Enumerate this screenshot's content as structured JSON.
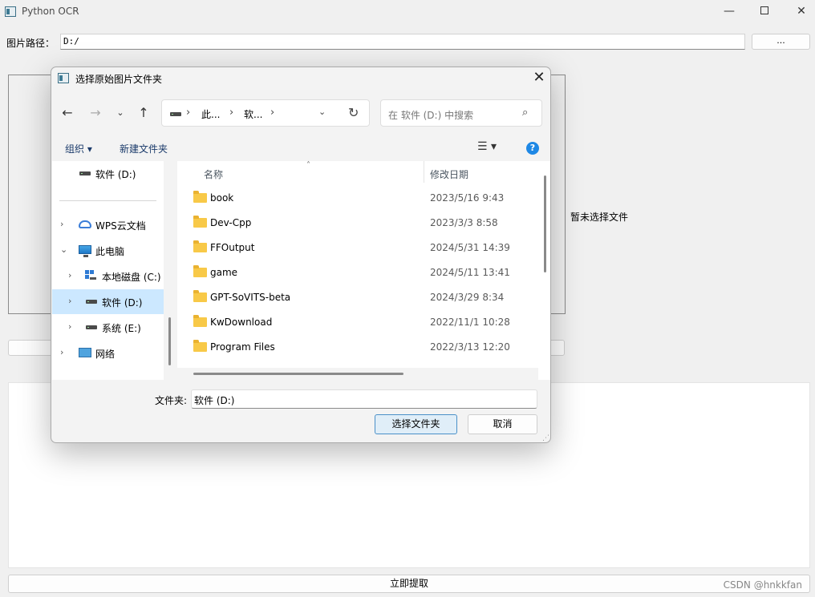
{
  "app": {
    "title": "Python OCR",
    "window_controls": {
      "minimize": "—",
      "close": "✕"
    }
  },
  "main": {
    "path_label": "图片路径：",
    "path_value": "D:/",
    "browse_label": "...",
    "no_file_text": "暂未选择文件",
    "extract_label": "立即提取",
    "watermark": "CSDN @hnkkfan"
  },
  "dialog": {
    "title": "选择原始图片文件夹",
    "close": "✕",
    "nav": {
      "back": "←",
      "forward": "→",
      "recent": "⌄",
      "up": "↑"
    },
    "address": {
      "crumbs": [
        "此...",
        "软..."
      ],
      "sep": "›",
      "dropdown": "⌄",
      "refresh": "↻"
    },
    "search_placeholder": "在 软件 (D:) 中搜索",
    "toolbar": {
      "organize": "组织 ▾",
      "new_folder": "新建文件夹",
      "view": "☰ ▾",
      "help": "?"
    },
    "nav_pane": {
      "items": [
        {
          "label": "软件 (D:)",
          "chevron": "",
          "icon": "drive-icon"
        },
        {
          "label": "WPS云文档",
          "chevron": "›",
          "icon": "cloud-icon"
        },
        {
          "label": "此电脑",
          "chevron": "⌄",
          "icon": "computer-icon"
        },
        {
          "label": "本地磁盘 (C:)",
          "chevron": "›",
          "icon": "windows-drive-icon"
        },
        {
          "label": "软件 (D:)",
          "chevron": "›",
          "icon": "drive-icon",
          "selected": true
        },
        {
          "label": "系统 (E:)",
          "chevron": "›",
          "icon": "drive-icon"
        },
        {
          "label": "网络",
          "chevron": "›",
          "icon": "network-icon"
        }
      ]
    },
    "columns": {
      "name": "名称",
      "sort_arrow": "˄",
      "date": "修改日期"
    },
    "files": [
      {
        "name": "book",
        "date": "2023/5/16 9:43"
      },
      {
        "name": "Dev-Cpp",
        "date": "2023/3/3 8:58"
      },
      {
        "name": "FFOutput",
        "date": "2024/5/31 14:39"
      },
      {
        "name": "game",
        "date": "2024/5/11 13:41"
      },
      {
        "name": "GPT-SoVITS-beta",
        "date": "2024/3/29 8:34"
      },
      {
        "name": "KwDownload",
        "date": "2022/11/1 10:28"
      },
      {
        "name": "Program Files",
        "date": "2022/3/13 12:20"
      }
    ],
    "folder_label": "文件夹:",
    "folder_value": "软件 (D:)",
    "select_label": "选择文件夹",
    "cancel_label": "取消"
  },
  "colors": {
    "accent": "#1e88e5",
    "selected_bg": "#cce8ff",
    "folder": "#f8c948"
  }
}
